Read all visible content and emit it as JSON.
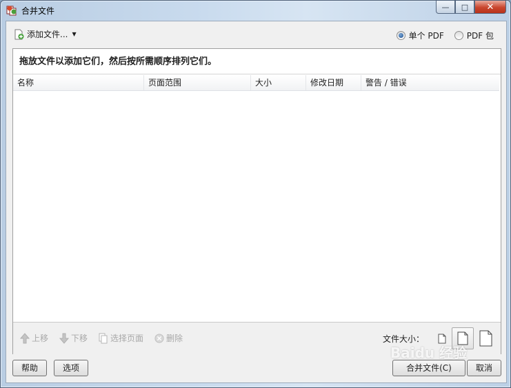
{
  "window": {
    "title": "合并文件",
    "controls": {
      "minimize": "—",
      "maximize": "□",
      "close": "✕"
    }
  },
  "toolbar": {
    "add_files_label": "添加文件...",
    "output_options": [
      {
        "label": "单个 PDF",
        "checked": true
      },
      {
        "label": "PDF 包",
        "checked": false
      }
    ]
  },
  "panel": {
    "instruction": "拖放文件以添加它们，然后按所需顺序排列它们。",
    "columns": [
      "名称",
      "页面范围",
      "大小",
      "修改日期",
      "警告 / 错误"
    ],
    "rows": []
  },
  "actions": [
    {
      "label": "上移",
      "icon": "arrow-up-icon",
      "enabled": false
    },
    {
      "label": "下移",
      "icon": "arrow-down-icon",
      "enabled": false
    },
    {
      "label": "选择页面",
      "icon": "pages-icon",
      "enabled": false
    },
    {
      "label": "删除",
      "icon": "delete-icon",
      "enabled": false
    }
  ],
  "file_size": {
    "label": "文件大小：",
    "options": [
      "small-file-icon",
      "medium-file-icon",
      "large-file-icon"
    ],
    "selected_index": 1
  },
  "footer": {
    "help_label": "帮助",
    "options_label": "选项",
    "merge_label": "合并文件(C)",
    "cancel_label": "取消"
  },
  "watermark": "Baidu 经验"
}
